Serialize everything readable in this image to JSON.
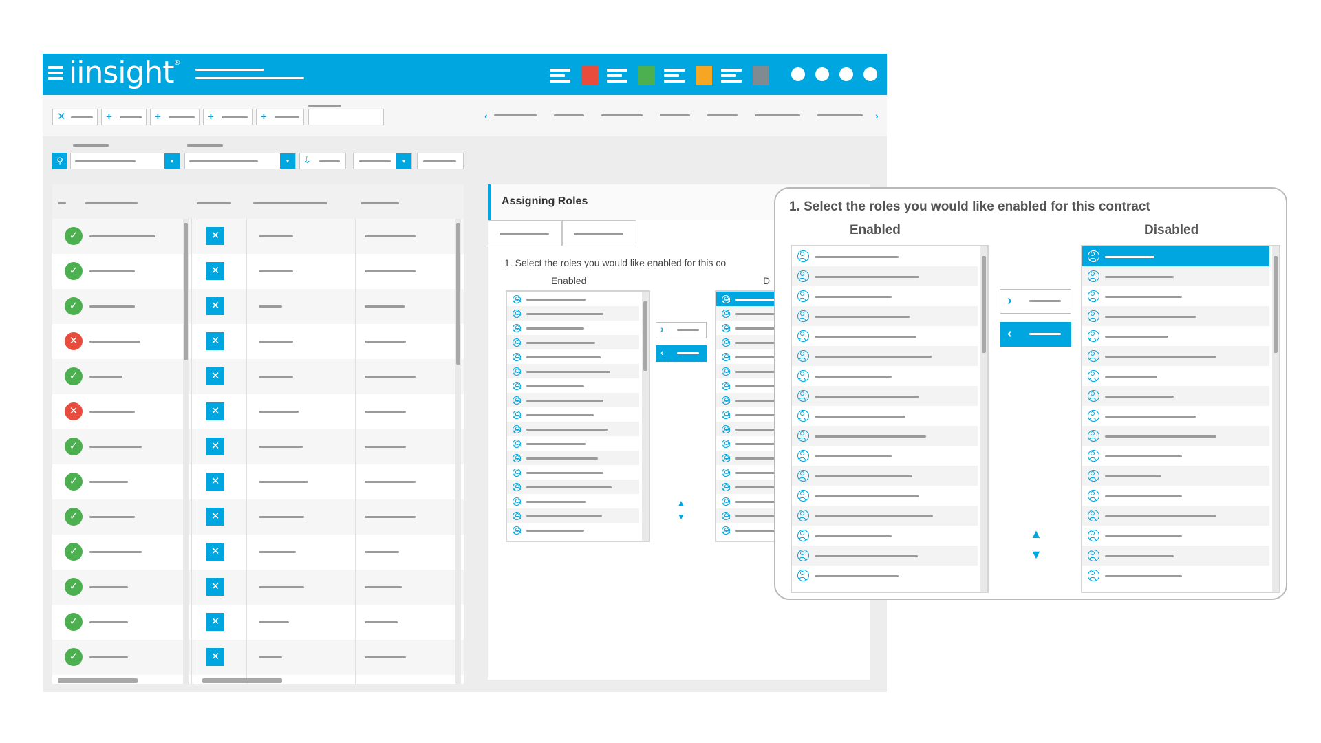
{
  "app": {
    "logo": "iinsight",
    "logo_mark": "®",
    "status_colors": [
      "#e74c3c",
      "#4caf50",
      "#f5a623",
      "#808a91"
    ]
  },
  "roles_panel": {
    "title": "Assigning Roles",
    "instruction": "1. Select the roles you would like enabled for this co",
    "enabled_label": "Enabled",
    "disabled_label": "D"
  },
  "zoom": {
    "instruction": "1. Select the roles you would like enabled for this contract",
    "enabled_label": "Enabled",
    "disabled_label": "Disabled"
  },
  "grid": {
    "row_status": [
      "ok",
      "ok",
      "ok",
      "bad",
      "ok",
      "bad",
      "ok",
      "ok",
      "ok",
      "ok",
      "ok",
      "ok",
      "ok"
    ]
  },
  "icons": {
    "ok": "✓",
    "bad": "✕",
    "remove": "✕",
    "add": "+",
    "search": "⚲",
    "dropdown": "▾",
    "right": "›",
    "left": "‹",
    "up": "▲",
    "down": "▼"
  }
}
